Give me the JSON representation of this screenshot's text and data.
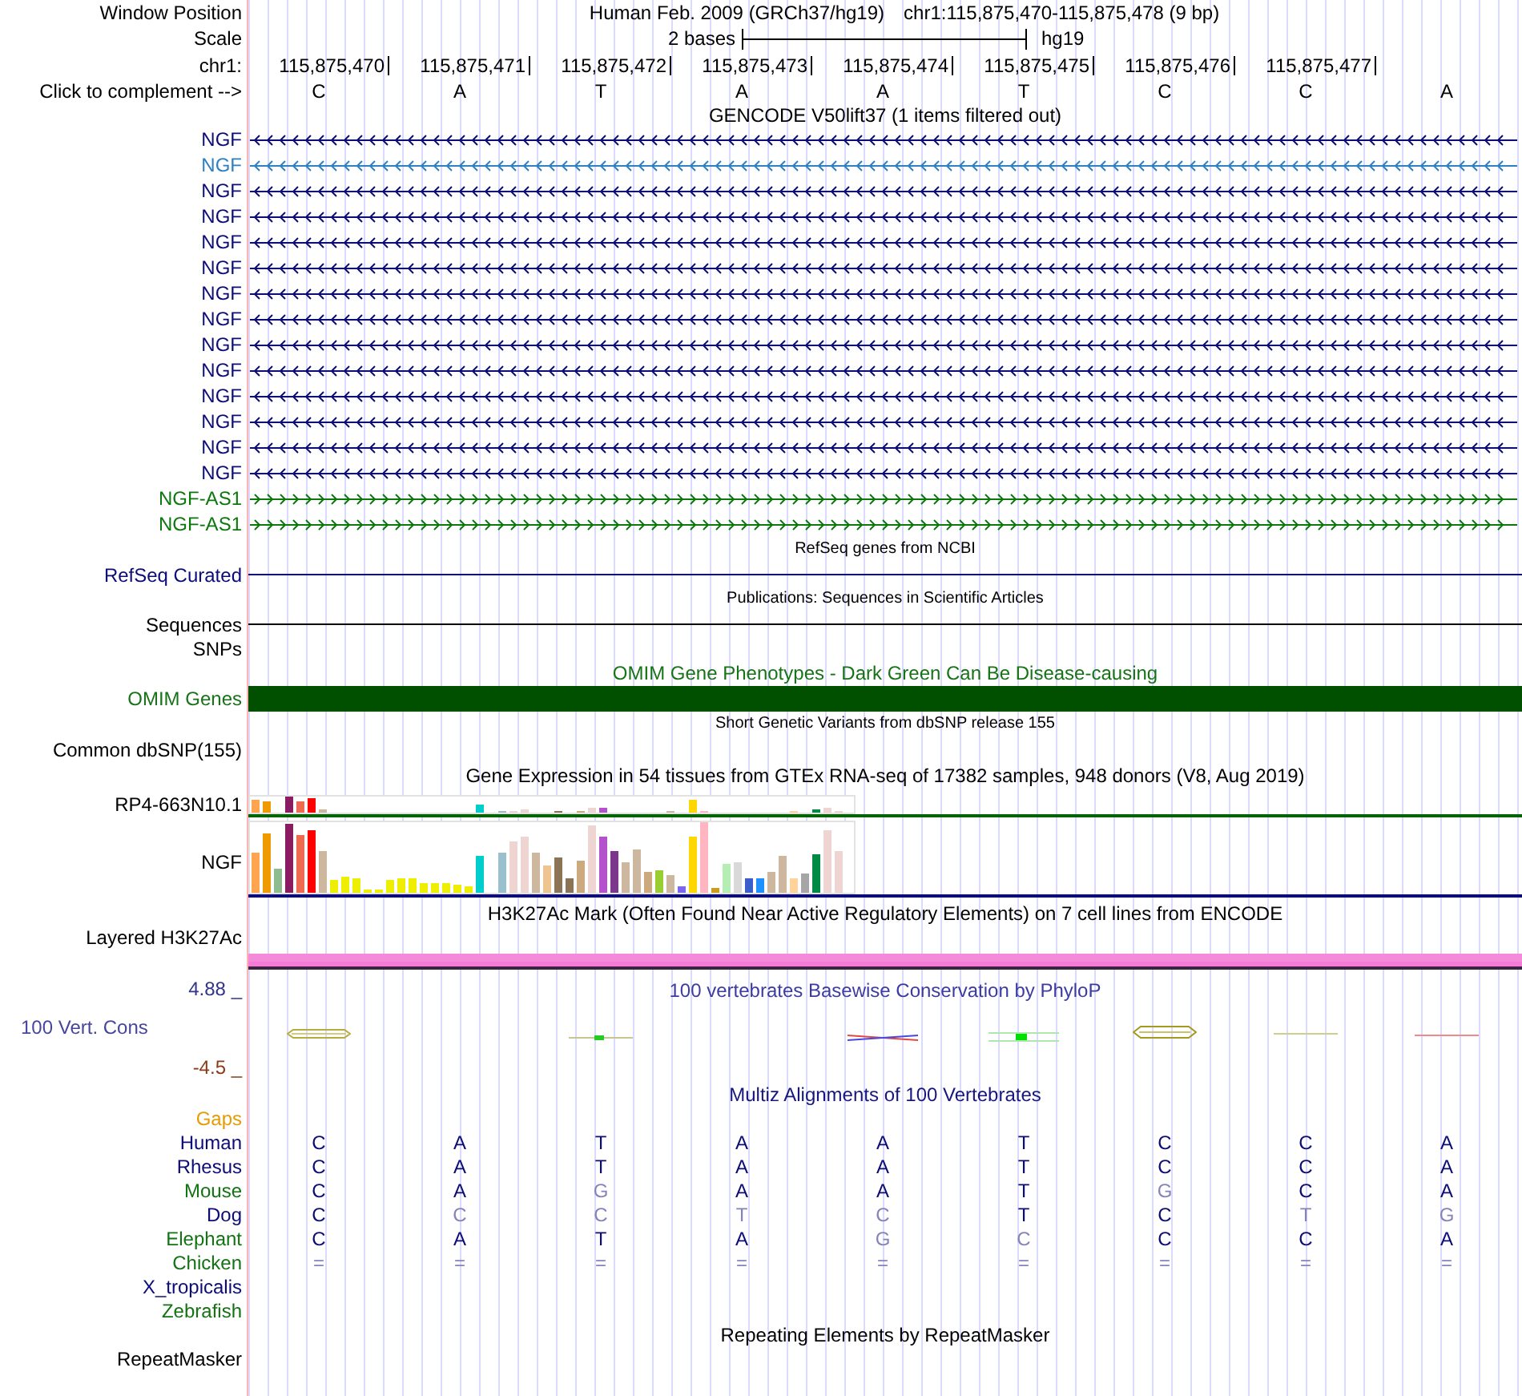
{
  "header": {
    "label": "Window Position",
    "assembly": "Human Feb. 2009 (GRCh37/hg19)",
    "position": "chr1:115,875,470-115,875,478 (9 bp)"
  },
  "scale": {
    "label": "Scale",
    "text": "2 bases",
    "assembly": "hg19"
  },
  "ruler": {
    "label": "chr1:",
    "positions": [
      "115,875,470",
      "115,875,471",
      "115,875,472",
      "115,875,473",
      "115,875,474",
      "115,875,475",
      "115,875,476",
      "115,875,477"
    ]
  },
  "sequence": {
    "link": "Click to complement -->",
    "bases": [
      "C",
      "A",
      "T",
      "A",
      "A",
      "T",
      "C",
      "C",
      "A"
    ]
  },
  "tracks": [
    {
      "kind": "genes",
      "title": "GENCODE V50lift37 (1 items filtered out)",
      "items": [
        {
          "name": "NGF",
          "color": "#0c0c78",
          "minus_strand": true
        },
        {
          "name": "NGF",
          "color": "#2c80c4",
          "minus_strand": true
        },
        {
          "name": "NGF",
          "color": "#0c0c78",
          "minus_strand": true
        },
        {
          "name": "NGF",
          "color": "#0c0c78",
          "minus_strand": true
        },
        {
          "name": "NGF",
          "color": "#0c0c78",
          "minus_strand": true
        },
        {
          "name": "NGF",
          "color": "#0c0c78",
          "minus_strand": true
        },
        {
          "name": "NGF",
          "color": "#0c0c78",
          "minus_strand": true
        },
        {
          "name": "NGF",
          "color": "#0c0c78",
          "minus_strand": true
        },
        {
          "name": "NGF",
          "color": "#0c0c78",
          "minus_strand": true
        },
        {
          "name": "NGF",
          "color": "#0c0c78",
          "minus_strand": true
        },
        {
          "name": "NGF",
          "color": "#0c0c78",
          "minus_strand": true
        },
        {
          "name": "NGF",
          "color": "#0c0c78",
          "minus_strand": true
        },
        {
          "name": "NGF",
          "color": "#0c0c78",
          "minus_strand": true
        },
        {
          "name": "NGF",
          "color": "#0c0c78",
          "minus_strand": true
        },
        {
          "name": "NGF-AS1",
          "color": "#0c780c",
          "minus_strand": false
        },
        {
          "name": "NGF-AS1",
          "color": "#0c780c",
          "minus_strand": false
        }
      ]
    },
    {
      "kind": "line",
      "title": "RefSeq genes from NCBI",
      "label": "RefSeq Curated",
      "color": "#0c0c78"
    },
    {
      "kind": "line",
      "title": "Publications: Sequences in Scientific Articles",
      "label": "Sequences",
      "color": "#000000"
    },
    {
      "kind": "label",
      "label": "SNPs"
    },
    {
      "kind": "bar",
      "title": "OMIM Gene Phenotypes - Dark Green Can Be Disease-causing",
      "label": "OMIM Genes",
      "color": "#005000"
    },
    {
      "kind": "snp",
      "title": "Short Genetic Variants from dbSNP release 155",
      "label": "Common dbSNP(155)"
    },
    {
      "kind": "expression",
      "title": "Gene Expression in 54 tissues from GTEx RNA-seq of 17382 samples, 948 donors (V8, Aug 2019)",
      "rows": [
        {
          "label": "RP4-663N10.1",
          "color": "#006400"
        },
        {
          "label": "NGF",
          "color": "#0c0c78"
        }
      ]
    },
    {
      "kind": "signal",
      "title": "H3K27Ac Mark (Often Found Near Active Regulatory Elements) on 7 cell lines from ENCODE",
      "label": "Layered H3K27Ac"
    },
    {
      "kind": "conservation",
      "title": "100 vertebrates Basewise Conservation by PhyloP",
      "label": "100 Vert. Cons",
      "max": "4.88 _",
      "min": "-4.5 _"
    },
    {
      "kind": "alignment",
      "title": "Multiz Alignments of 100 Vertebrates",
      "rows": [
        {
          "name": "Gaps",
          "color": "#e89a00"
        },
        {
          "name": "Human",
          "color": "#0c0c78",
          "bases": [
            {
              "base": "C",
              "match": true
            },
            {
              "base": "A",
              "match": true
            },
            {
              "base": "T",
              "match": true
            },
            {
              "base": "A",
              "match": true
            },
            {
              "base": "A",
              "match": true
            },
            {
              "base": "T",
              "match": true
            },
            {
              "base": "C",
              "match": true
            },
            {
              "base": "C",
              "match": true
            },
            {
              "base": "A",
              "match": true
            }
          ]
        },
        {
          "name": "Rhesus",
          "color": "#0c0c78",
          "bases": [
            {
              "base": "C",
              "match": true
            },
            {
              "base": "A",
              "match": true
            },
            {
              "base": "T",
              "match": true
            },
            {
              "base": "A",
              "match": true
            },
            {
              "base": "A",
              "match": true
            },
            {
              "base": "T",
              "match": true
            },
            {
              "base": "C",
              "match": true
            },
            {
              "base": "C",
              "match": true
            },
            {
              "base": "A",
              "match": true
            }
          ]
        },
        {
          "name": "Mouse",
          "color": "#137313",
          "bases": [
            {
              "base": "C",
              "match": true
            },
            {
              "base": "A",
              "match": true
            },
            {
              "base": "G",
              "match": false
            },
            {
              "base": "A",
              "match": true
            },
            {
              "base": "A",
              "match": true
            },
            {
              "base": "T",
              "match": true
            },
            {
              "base": "G",
              "match": false
            },
            {
              "base": "C",
              "match": true
            },
            {
              "base": "A",
              "match": true
            }
          ]
        },
        {
          "name": "Dog",
          "color": "#0c0c78",
          "bases": [
            {
              "base": "C",
              "match": true
            },
            {
              "base": "C",
              "match": false
            },
            {
              "base": "C",
              "match": false
            },
            {
              "base": "T",
              "match": false
            },
            {
              "base": "C",
              "match": false
            },
            {
              "base": "T",
              "match": true
            },
            {
              "base": "C",
              "match": true
            },
            {
              "base": "T",
              "match": false
            },
            {
              "base": "G",
              "match": false
            }
          ]
        },
        {
          "name": "Elephant",
          "color": "#137313",
          "bases": [
            {
              "base": "C",
              "match": true
            },
            {
              "base": "A",
              "match": true
            },
            {
              "base": "T",
              "match": true
            },
            {
              "base": "A",
              "match": true
            },
            {
              "base": "G",
              "match": false
            },
            {
              "base": "C",
              "match": false
            },
            {
              "base": "C",
              "match": true
            },
            {
              "base": "C",
              "match": true
            },
            {
              "base": "A",
              "match": true
            }
          ]
        },
        {
          "name": "Chicken",
          "color": "#137313",
          "bases": [
            {
              "base": "=",
              "match": false
            },
            {
              "base": "=",
              "match": false
            },
            {
              "base": "=",
              "match": false
            },
            {
              "base": "=",
              "match": false
            },
            {
              "base": "=",
              "match": false
            },
            {
              "base": "=",
              "match": false
            },
            {
              "base": "=",
              "match": false
            },
            {
              "base": "=",
              "match": false
            },
            {
              "base": "=",
              "match": false
            }
          ]
        },
        {
          "name": "X_tropicalis",
          "color": "#0c0c78"
        },
        {
          "name": "Zebrafish",
          "color": "#137313"
        }
      ]
    },
    {
      "kind": "repeats",
      "title": "Repeating Elements by RepeatMasker",
      "label": "RepeatMasker"
    }
  ]
}
